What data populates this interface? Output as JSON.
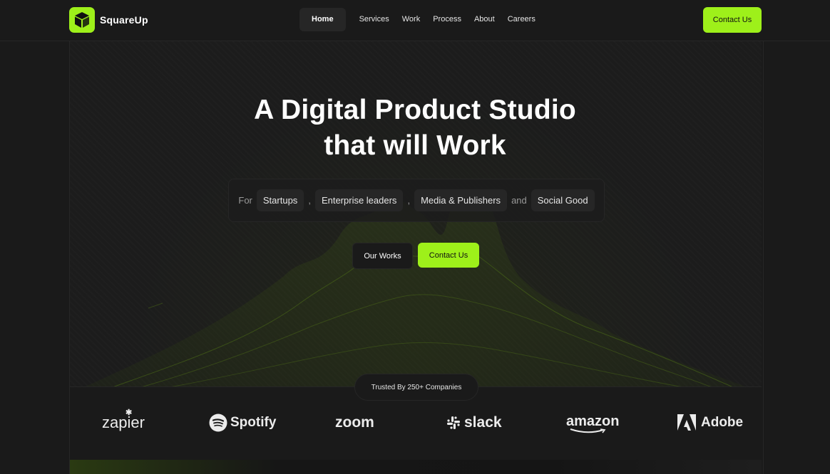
{
  "brand": {
    "name": "SquareUp",
    "logo_icon": "cube-icon",
    "accent": "#9ef01a"
  },
  "nav": {
    "items": [
      {
        "label": "Home",
        "active": true
      },
      {
        "label": "Services"
      },
      {
        "label": "Work"
      },
      {
        "label": "Process"
      },
      {
        "label": "About"
      },
      {
        "label": "Careers"
      }
    ],
    "cta": "Contact Us"
  },
  "hero": {
    "title_line1": "A Digital Product Studio",
    "title_line2": "that will Work",
    "for_label": "For",
    "audiences": [
      "Startups",
      "Enterprise leaders",
      "Media & Publishers",
      "Social Good"
    ],
    "separators": [
      ",",
      ",",
      "and"
    ],
    "primary_button": "Our Works",
    "secondary_button": "Contact Us"
  },
  "trusted": {
    "badge": "Trusted By 250+ Companies",
    "logos": [
      "zapier",
      "Spotify",
      "zoom",
      "slack",
      "amazon",
      "Adobe"
    ]
  }
}
